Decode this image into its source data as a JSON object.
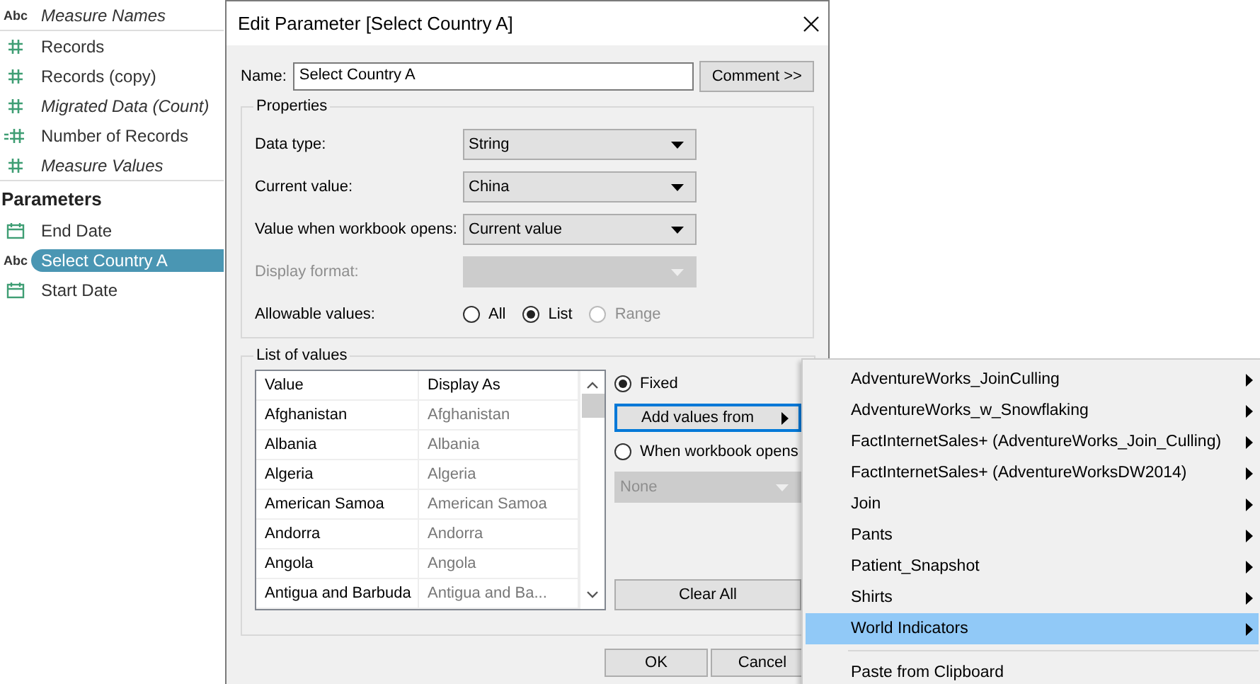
{
  "sidebar": {
    "top_fields": [
      {
        "name": "Measure Names",
        "kind": "string",
        "icon_text": "Abc",
        "generated": true
      }
    ],
    "measures": [
      {
        "name": "Records",
        "kind": "measure",
        "generated": false
      },
      {
        "name": "Records (copy)",
        "kind": "measure",
        "generated": false
      },
      {
        "name": "Migrated Data (Count)",
        "kind": "measure",
        "generated": true
      },
      {
        "name": "Number of Records",
        "kind": "calc_measure",
        "generated": false
      },
      {
        "name": "Measure Values",
        "kind": "measure",
        "generated": true
      }
    ],
    "parameters": {
      "heading": "Parameters",
      "items": [
        {
          "name": "End Date",
          "kind": "date",
          "selected": false
        },
        {
          "name": "Select Country A",
          "kind": "string",
          "icon_text": "Abc",
          "selected": true
        },
        {
          "name": "Start Date",
          "kind": "date",
          "selected": false
        }
      ]
    }
  },
  "dialog": {
    "title": "Edit Parameter [Select Country A]",
    "name_label": "Name:",
    "name_value": "Select Country A",
    "comment_button": "Comment >>",
    "properties": {
      "legend": "Properties",
      "rows": [
        {
          "label": "Data type:",
          "value": "String",
          "disabled": false
        },
        {
          "label": "Current value:",
          "value": "China",
          "disabled": false
        },
        {
          "label": "Value when workbook opens:",
          "value": "Current value",
          "disabled": false
        },
        {
          "label": "Display format:",
          "disabled": true
        }
      ],
      "allowable": {
        "label": "Allowable values:",
        "options": [
          {
            "label": "All",
            "selected": false,
            "disabled": false
          },
          {
            "label": "List",
            "selected": true,
            "disabled": false
          },
          {
            "label": "Range",
            "selected": false,
            "disabled": true
          }
        ]
      }
    },
    "list_of_values": {
      "legend": "List of values",
      "columns": [
        "Value",
        "Display As"
      ],
      "rows": [
        {
          "value": "Afghanistan",
          "display_as": "Afghanistan"
        },
        {
          "value": "Albania",
          "display_as": "Albania"
        },
        {
          "value": "Algeria",
          "display_as": "Algeria"
        },
        {
          "value": "American Samoa",
          "display_as": "American Samoa"
        },
        {
          "value": "Andorra",
          "display_as": "Andorra"
        },
        {
          "value": "Angola",
          "display_as": "Angola"
        },
        {
          "value": "Antigua and Barbuda",
          "display_as": "Antigua and Ba..."
        }
      ],
      "source_options": [
        {
          "label": "Fixed",
          "selected": true
        },
        {
          "label": "When workbook opens",
          "selected": false
        }
      ],
      "add_values_button": {
        "label": "Add values from",
        "focused": true
      },
      "workbook_dropdown": {
        "value": "None",
        "disabled": true
      },
      "clear_button": "Clear All"
    },
    "buttons": [
      "OK",
      "Cancel"
    ]
  },
  "context_menu": {
    "items": [
      {
        "label": "AdventureWorks_JoinCulling",
        "submenu": true,
        "selected": false,
        "separator_before": false
      },
      {
        "label": "AdventureWorks_w_Snowflaking",
        "submenu": true,
        "selected": false,
        "separator_before": false
      },
      {
        "label": "FactInternetSales+ (AdventureWorks_Join_Culling)",
        "submenu": true,
        "selected": false,
        "separator_before": false
      },
      {
        "label": "FactInternetSales+ (AdventureWorksDW2014)",
        "submenu": true,
        "selected": false,
        "separator_before": false
      },
      {
        "label": "Join",
        "submenu": true,
        "selected": false,
        "separator_before": false
      },
      {
        "label": "Pants",
        "submenu": true,
        "selected": false,
        "separator_before": false
      },
      {
        "label": "Patient_Snapshot",
        "submenu": true,
        "selected": false,
        "separator_before": false
      },
      {
        "label": "Shirts",
        "submenu": true,
        "selected": false,
        "separator_before": false
      },
      {
        "label": "World Indicators",
        "submenu": true,
        "selected": true,
        "separator_before": false
      },
      {
        "label": "Paste from Clipboard",
        "submenu": false,
        "selected": false,
        "separator_before": true
      }
    ]
  }
}
